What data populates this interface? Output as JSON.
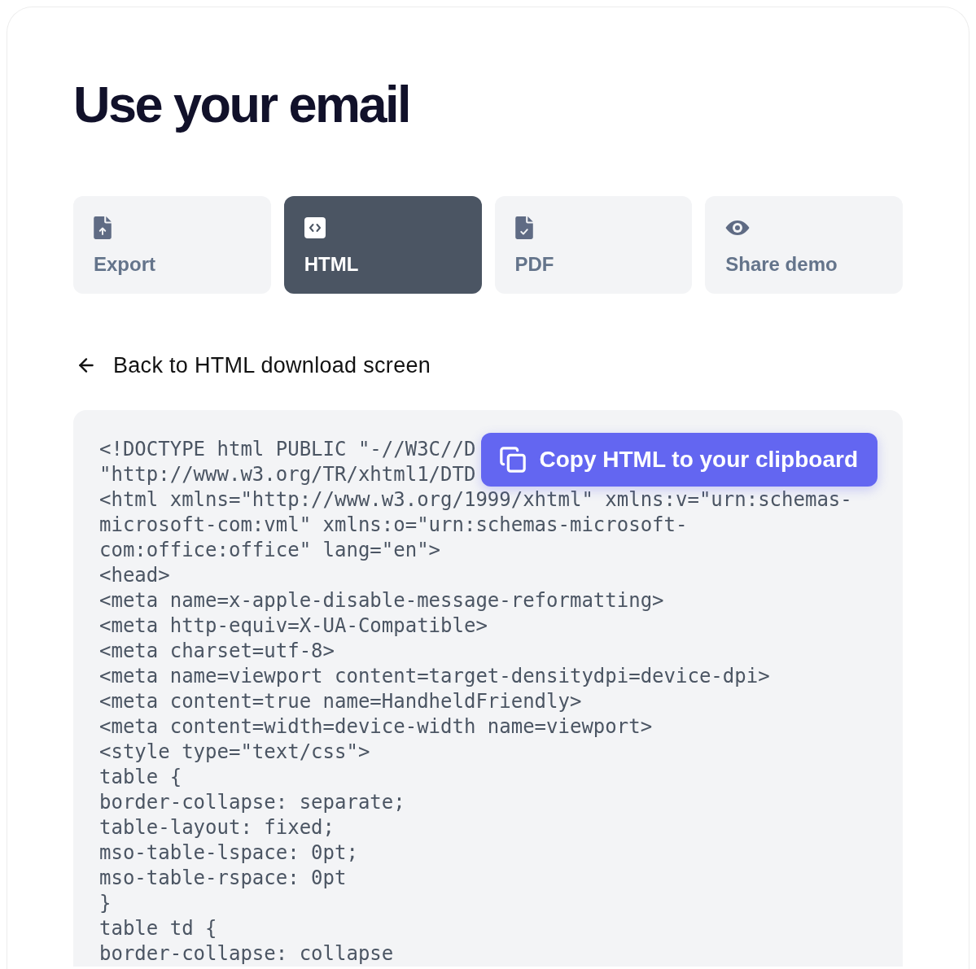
{
  "page": {
    "title": "Use your email"
  },
  "tabs": [
    {
      "label": "Export",
      "selected": false
    },
    {
      "label": "HTML",
      "selected": true
    },
    {
      "label": "PDF",
      "selected": false
    },
    {
      "label": "Share demo",
      "selected": false
    }
  ],
  "back_link": {
    "label": "Back to HTML download screen"
  },
  "code_block": {
    "lines": [
      "<!DOCTYPE html PUBLIC \"-//W3C//D",
      "\"http://www.w3.org/TR/xhtml1/DTD",
      "<html xmlns=\"http://www.w3.org/1999/xhtml\" xmlns:v=\"urn:schemas-",
      "microsoft-com:vml\" xmlns:o=\"urn:schemas-microsoft-",
      "com:office:office\" lang=\"en\">",
      "<head>",
      "<meta name=x-apple-disable-message-reformatting>",
      "<meta http-equiv=X-UA-Compatible>",
      "<meta charset=utf-8>",
      "<meta name=viewport content=target-densitydpi=device-dpi>",
      "<meta content=true name=HandheldFriendly>",
      "<meta content=width=device-width name=viewport>",
      "<style type=\"text/css\">",
      "table {",
      "border-collapse: separate;",
      "table-layout: fixed;",
      "mso-table-lspace: 0pt;",
      "mso-table-rspace: 0pt",
      "}",
      "table td {",
      "border-collapse: collapse"
    ],
    "copy_button": {
      "label": "Copy HTML to your clipboard"
    }
  }
}
